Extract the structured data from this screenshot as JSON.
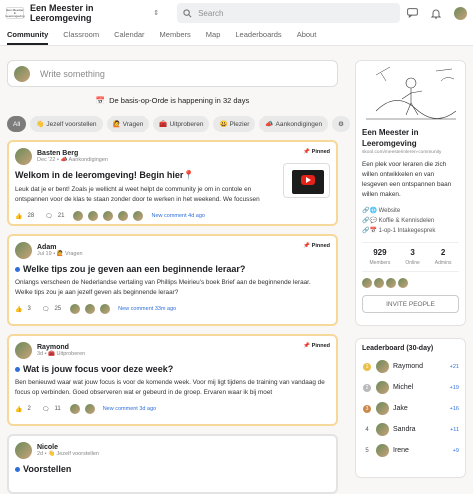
{
  "app": {
    "logo_text": "Een Meester in Leeromgeving",
    "name": "Een Meester in Leeromgeving"
  },
  "search": {
    "placeholder": "Search"
  },
  "nav": {
    "tabs": [
      "Community",
      "Classroom",
      "Calendar",
      "Members",
      "Map",
      "Leaderboards",
      "About"
    ]
  },
  "composer": {
    "placeholder": "Write something"
  },
  "event_banner": {
    "text": "De basis-op-Orde is happening in 32 days"
  },
  "filters": [
    {
      "label": "All",
      "emoji": ""
    },
    {
      "label": "Jezelf voorstellen",
      "emoji": "👋"
    },
    {
      "label": "Vragen",
      "emoji": "🙋"
    },
    {
      "label": "Uitproberen",
      "emoji": "🧰"
    },
    {
      "label": "Plezier",
      "emoji": "😃"
    },
    {
      "label": "Aankondigingen",
      "emoji": "📣"
    }
  ],
  "posts": [
    {
      "author": "Basten Berg",
      "meta": "Dec '22 • 📣 Aankondigingen",
      "pinned": "Pinned",
      "title": "Welkom in de leeromgeving! Begin hier📍",
      "body": "Leuk dat je er bent! Zoals je wellicht al weet helpt de community je om in contole en ontspannen voor de klas te staan zonder door te werken in het weekend. We focussen",
      "likes": "28",
      "comments": "21",
      "new_comment": "New comment 4d ago"
    },
    {
      "author": "Adam",
      "meta": "Jul 19 • 🙋 Vragen",
      "pinned": "Pinned",
      "title": "Welke tips zou je geven aan een beginnende leraar?",
      "body": "Onlangs verscheen de Nederlandse vertaling van Phillips Meirieu's boek Brief aan de beginnende leraar. Welke tips zou je aan jezelf geven als beginnende leraar?",
      "likes": "3",
      "comments": "25",
      "new_comment": "New comment 33m ago"
    },
    {
      "author": "Raymond",
      "meta": "3d • 🧰 Uitproberen",
      "pinned": "Pinned",
      "title": "Wat is jouw focus voor deze week?",
      "body": "Ben benieuwd waar wat jouw focus is voor de komende week. Voor mij ligt tijdens de training van vandaag de focus op verbinden. Goed observeren wat er gebeurd in de groep. Ervaren waar ik bij moet",
      "likes": "2",
      "comments": "11",
      "new_comment": "New comment 3d ago"
    },
    {
      "author": "Nicole",
      "meta": "2d • 👋 Jezelf voorstellen",
      "title": "Voorstellen"
    }
  ],
  "community": {
    "name": "Een Meester in Leeromgeving",
    "url": "skool.com/meesterinleren-community",
    "description": "Een plek voor leraren die zich willen ontwikkelen en van lesgeven een ontspannen baan willen maken.",
    "links": [
      "Website",
      "Koffie & Kennisdelen",
      "1-op-1 Intakegesprek"
    ],
    "stats": [
      {
        "value": "929",
        "label": "Members"
      },
      {
        "value": "3",
        "label": "Online"
      },
      {
        "value": "2",
        "label": "Admins"
      }
    ],
    "invite_label": "INVITE PEOPLE"
  },
  "leaderboard": {
    "title": "Leaderboard (30-day)",
    "rows": [
      {
        "rank": "1",
        "name": "Raymond",
        "points": "+21"
      },
      {
        "rank": "2",
        "name": "Michel",
        "points": "+19"
      },
      {
        "rank": "3",
        "name": "Jake",
        "points": "+16"
      },
      {
        "rank": "4",
        "name": "Sandra",
        "points": "+11"
      },
      {
        "rank": "5",
        "name": "Irene",
        "points": "+9"
      }
    ]
  }
}
